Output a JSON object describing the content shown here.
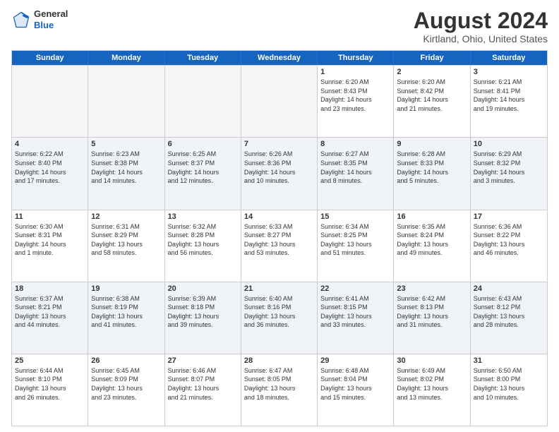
{
  "header": {
    "logo": {
      "general": "General",
      "blue": "Blue"
    },
    "title": "August 2024",
    "subtitle": "Kirtland, Ohio, United States"
  },
  "weekdays": [
    "Sunday",
    "Monday",
    "Tuesday",
    "Wednesday",
    "Thursday",
    "Friday",
    "Saturday"
  ],
  "rows": [
    [
      {
        "day": "",
        "info": "",
        "empty": true
      },
      {
        "day": "",
        "info": "",
        "empty": true
      },
      {
        "day": "",
        "info": "",
        "empty": true
      },
      {
        "day": "",
        "info": "",
        "empty": true
      },
      {
        "day": "1",
        "info": "Sunrise: 6:20 AM\nSunset: 8:43 PM\nDaylight: 14 hours\nand 23 minutes."
      },
      {
        "day": "2",
        "info": "Sunrise: 6:20 AM\nSunset: 8:42 PM\nDaylight: 14 hours\nand 21 minutes."
      },
      {
        "day": "3",
        "info": "Sunrise: 6:21 AM\nSunset: 8:41 PM\nDaylight: 14 hours\nand 19 minutes."
      }
    ],
    [
      {
        "day": "4",
        "info": "Sunrise: 6:22 AM\nSunset: 8:40 PM\nDaylight: 14 hours\nand 17 minutes."
      },
      {
        "day": "5",
        "info": "Sunrise: 6:23 AM\nSunset: 8:38 PM\nDaylight: 14 hours\nand 14 minutes."
      },
      {
        "day": "6",
        "info": "Sunrise: 6:25 AM\nSunset: 8:37 PM\nDaylight: 14 hours\nand 12 minutes."
      },
      {
        "day": "7",
        "info": "Sunrise: 6:26 AM\nSunset: 8:36 PM\nDaylight: 14 hours\nand 10 minutes."
      },
      {
        "day": "8",
        "info": "Sunrise: 6:27 AM\nSunset: 8:35 PM\nDaylight: 14 hours\nand 8 minutes."
      },
      {
        "day": "9",
        "info": "Sunrise: 6:28 AM\nSunset: 8:33 PM\nDaylight: 14 hours\nand 5 minutes."
      },
      {
        "day": "10",
        "info": "Sunrise: 6:29 AM\nSunset: 8:32 PM\nDaylight: 14 hours\nand 3 minutes."
      }
    ],
    [
      {
        "day": "11",
        "info": "Sunrise: 6:30 AM\nSunset: 8:31 PM\nDaylight: 14 hours\nand 1 minute."
      },
      {
        "day": "12",
        "info": "Sunrise: 6:31 AM\nSunset: 8:29 PM\nDaylight: 13 hours\nand 58 minutes."
      },
      {
        "day": "13",
        "info": "Sunrise: 6:32 AM\nSunset: 8:28 PM\nDaylight: 13 hours\nand 56 minutes."
      },
      {
        "day": "14",
        "info": "Sunrise: 6:33 AM\nSunset: 8:27 PM\nDaylight: 13 hours\nand 53 minutes."
      },
      {
        "day": "15",
        "info": "Sunrise: 6:34 AM\nSunset: 8:25 PM\nDaylight: 13 hours\nand 51 minutes."
      },
      {
        "day": "16",
        "info": "Sunrise: 6:35 AM\nSunset: 8:24 PM\nDaylight: 13 hours\nand 49 minutes."
      },
      {
        "day": "17",
        "info": "Sunrise: 6:36 AM\nSunset: 8:22 PM\nDaylight: 13 hours\nand 46 minutes."
      }
    ],
    [
      {
        "day": "18",
        "info": "Sunrise: 6:37 AM\nSunset: 8:21 PM\nDaylight: 13 hours\nand 44 minutes."
      },
      {
        "day": "19",
        "info": "Sunrise: 6:38 AM\nSunset: 8:19 PM\nDaylight: 13 hours\nand 41 minutes."
      },
      {
        "day": "20",
        "info": "Sunrise: 6:39 AM\nSunset: 8:18 PM\nDaylight: 13 hours\nand 39 minutes."
      },
      {
        "day": "21",
        "info": "Sunrise: 6:40 AM\nSunset: 8:16 PM\nDaylight: 13 hours\nand 36 minutes."
      },
      {
        "day": "22",
        "info": "Sunrise: 6:41 AM\nSunset: 8:15 PM\nDaylight: 13 hours\nand 33 minutes."
      },
      {
        "day": "23",
        "info": "Sunrise: 6:42 AM\nSunset: 8:13 PM\nDaylight: 13 hours\nand 31 minutes."
      },
      {
        "day": "24",
        "info": "Sunrise: 6:43 AM\nSunset: 8:12 PM\nDaylight: 13 hours\nand 28 minutes."
      }
    ],
    [
      {
        "day": "25",
        "info": "Sunrise: 6:44 AM\nSunset: 8:10 PM\nDaylight: 13 hours\nand 26 minutes."
      },
      {
        "day": "26",
        "info": "Sunrise: 6:45 AM\nSunset: 8:09 PM\nDaylight: 13 hours\nand 23 minutes."
      },
      {
        "day": "27",
        "info": "Sunrise: 6:46 AM\nSunset: 8:07 PM\nDaylight: 13 hours\nand 21 minutes."
      },
      {
        "day": "28",
        "info": "Sunrise: 6:47 AM\nSunset: 8:05 PM\nDaylight: 13 hours\nand 18 minutes."
      },
      {
        "day": "29",
        "info": "Sunrise: 6:48 AM\nSunset: 8:04 PM\nDaylight: 13 hours\nand 15 minutes."
      },
      {
        "day": "30",
        "info": "Sunrise: 6:49 AM\nSunset: 8:02 PM\nDaylight: 13 hours\nand 13 minutes."
      },
      {
        "day": "31",
        "info": "Sunrise: 6:50 AM\nSunset: 8:00 PM\nDaylight: 13 hours\nand 10 minutes."
      }
    ]
  ]
}
